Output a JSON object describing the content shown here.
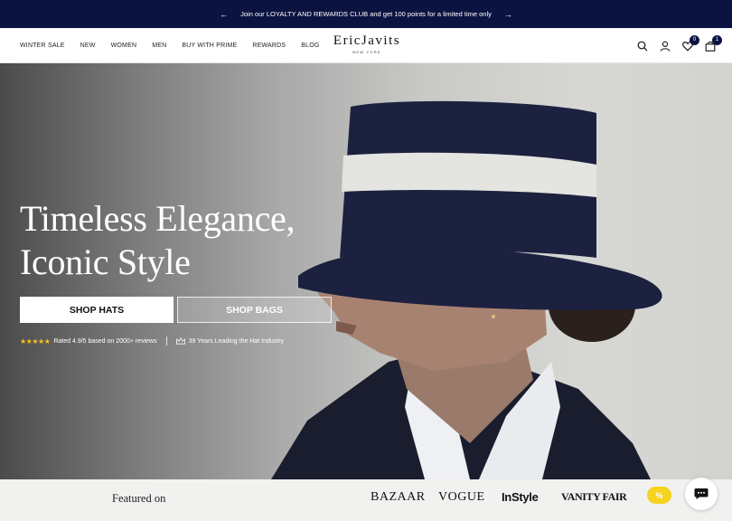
{
  "announcement": {
    "text": "Join our LOYALTY AND REWARDS CLUB and get 100 points for a limited time only",
    "prev_icon": "arrow-left-icon",
    "next_icon": "arrow-right-icon"
  },
  "nav": {
    "items": [
      {
        "label": "WINTER SALE"
      },
      {
        "label": "NEW"
      },
      {
        "label": "WOMEN"
      },
      {
        "label": "MEN"
      },
      {
        "label": "BUY WITH PRIME"
      },
      {
        "label": "REWARDS"
      },
      {
        "label": "BLOG"
      }
    ]
  },
  "logo": {
    "name": "EricJavits",
    "sub": "NEW YORK"
  },
  "header_icons": {
    "search": "search-icon",
    "account": "user-icon",
    "wishlist": "heart-icon",
    "wishlist_count": "0",
    "cart": "bag-icon",
    "cart_count": "1"
  },
  "hero": {
    "title_line1": "Timeless Elegance,",
    "title_line2": "Iconic Style",
    "btn_primary": "SHOP HATS",
    "btn_secondary": "SHOP BAGS",
    "stars": "★★★★★",
    "rating_text": "Rated 4.9/5 based on 2000+ reviews",
    "years_text": "39 Years Leading the Hat Industry"
  },
  "featured": {
    "label": "Featured on",
    "press": [
      "BAZAAR",
      "VOGUE",
      "InStyle",
      "VANITY FAIR"
    ],
    "promo_symbol": "%"
  },
  "colors": {
    "announcement_bg": "#0b1440",
    "star": "#f5c518",
    "promo": "#f5d31e",
    "hat": "#1c2140"
  }
}
